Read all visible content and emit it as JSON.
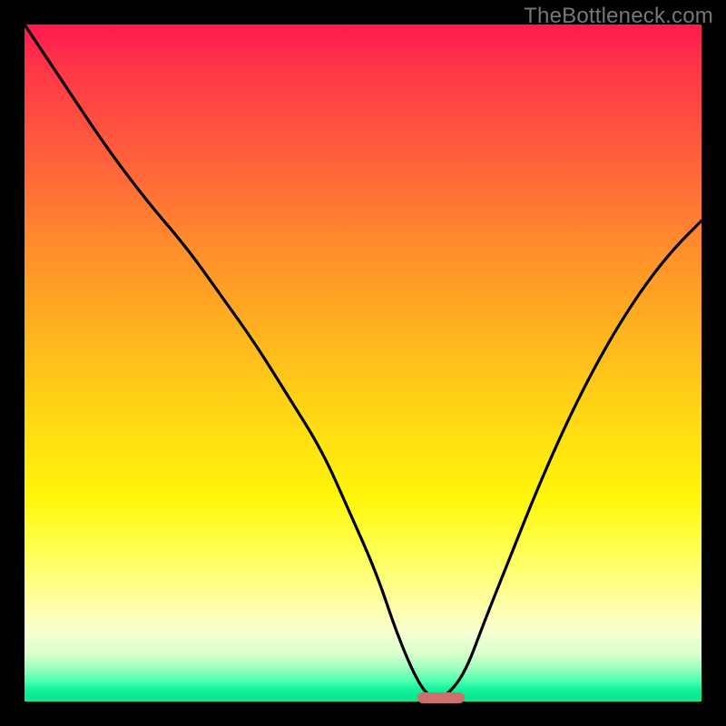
{
  "watermark": "TheBottleneck.com",
  "colors": {
    "frame": "#000000",
    "curve": "#000000",
    "marker": "#cd6f6a",
    "gradient_stops": [
      "#ff1a4d",
      "#ff3448",
      "#ff5a3d",
      "#ff8a2d",
      "#ffb21f",
      "#ffd814",
      "#fff60a",
      "#ffff55",
      "#ffffaa",
      "#f5ffd2",
      "#d9ffcc",
      "#9dffc0",
      "#4effb0",
      "#19f59f",
      "#0ce890"
    ]
  },
  "chart_data": {
    "type": "line",
    "title": "",
    "xlabel": "",
    "ylabel": "",
    "xlim": [
      0,
      100
    ],
    "ylim": [
      0,
      100
    ],
    "series": [
      {
        "name": "bottleneck-curve",
        "x": [
          0,
          6,
          12,
          18,
          24,
          29,
          34,
          39,
          44,
          48,
          52,
          55,
          58,
          60,
          62,
          65,
          68,
          72,
          76,
          80,
          84,
          88,
          92,
          96,
          100
        ],
        "y": [
          100,
          91,
          82,
          74,
          67,
          60,
          53,
          45,
          37,
          28,
          19,
          10,
          3,
          0.5,
          0.5,
          4,
          12,
          22,
          32,
          41,
          49,
          56,
          62,
          67,
          71
        ]
      }
    ],
    "marker": {
      "x_start": 58,
      "x_end": 65,
      "y": 0.5
    }
  }
}
